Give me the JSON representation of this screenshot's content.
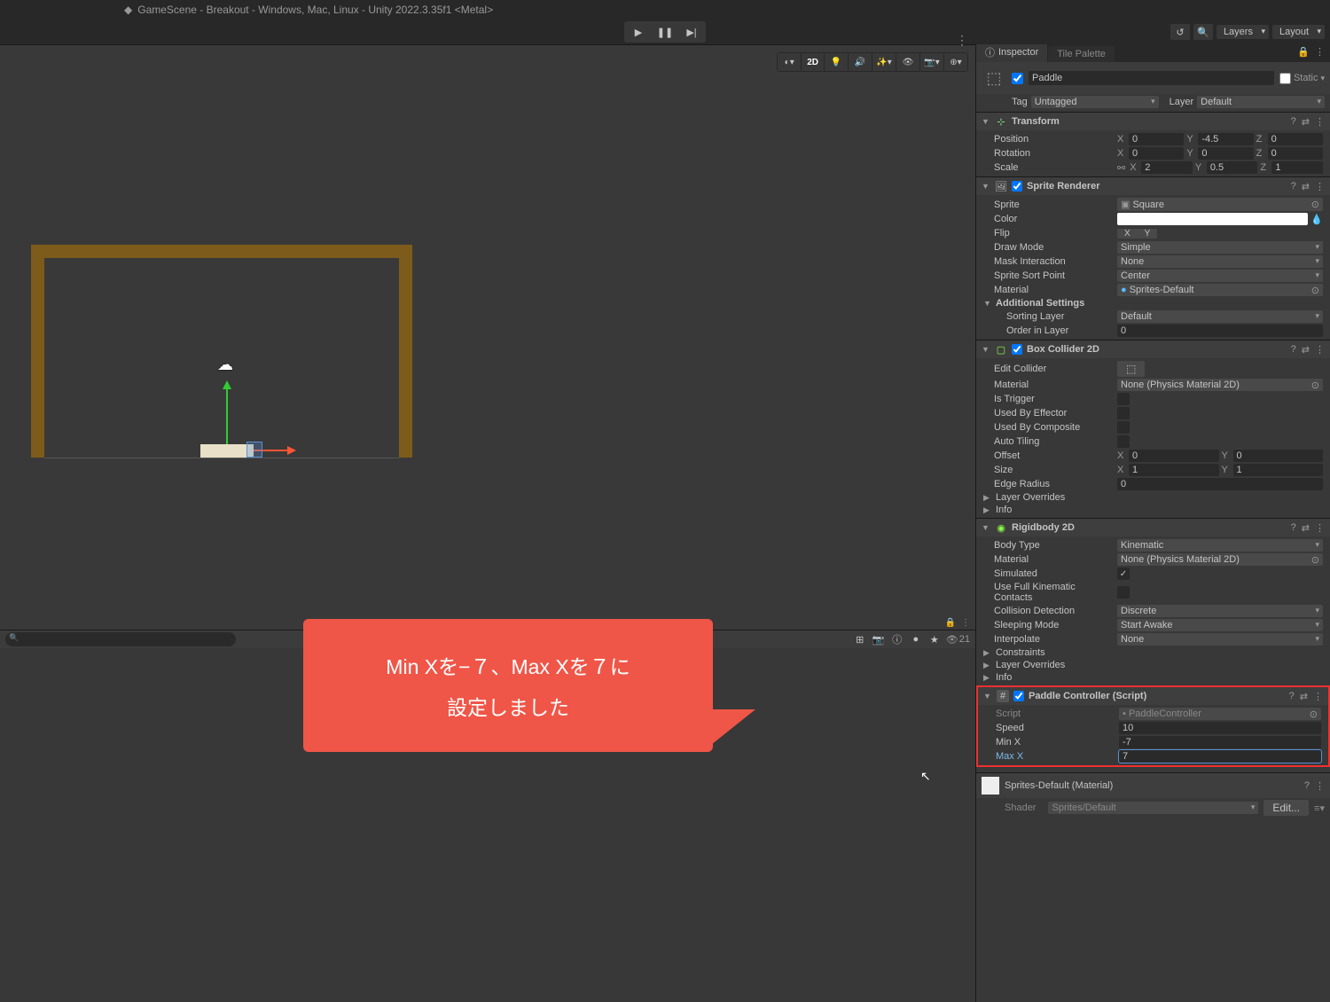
{
  "title": "GameScene - Breakout - Windows, Mac, Linux - Unity 2022.3.35f1 <Metal>",
  "toolbar": {
    "layers": "Layers",
    "layout": "Layout"
  },
  "tabs": {
    "inspector": "Inspector",
    "tilepalette": "Tile Palette"
  },
  "obj": {
    "name": "Paddle",
    "static": "Static",
    "tag_lbl": "Tag",
    "tag": "Untagged",
    "layer_lbl": "Layer",
    "layer": "Default"
  },
  "transform": {
    "title": "Transform",
    "pos_lbl": "Position",
    "px": "0",
    "py": "-4.5",
    "pz": "0",
    "rot_lbl": "Rotation",
    "rx": "0",
    "ry": "0",
    "rz": "0",
    "scl_lbl": "Scale",
    "sx": "2",
    "sy": "0.5",
    "sz": "1"
  },
  "sprite": {
    "title": "Sprite Renderer",
    "sprite_lbl": "Sprite",
    "sprite": "Square",
    "color_lbl": "Color",
    "flip_lbl": "Flip",
    "flip_x": "X",
    "flip_y": "Y",
    "draw_lbl": "Draw Mode",
    "draw": "Simple",
    "mask_lbl": "Mask Interaction",
    "mask": "None",
    "sort_lbl": "Sprite Sort Point",
    "sort": "Center",
    "mat_lbl": "Material",
    "mat": "Sprites-Default",
    "addl": "Additional Settings",
    "slayer_lbl": "Sorting Layer",
    "slayer": "Default",
    "order_lbl": "Order in Layer",
    "order": "0"
  },
  "box": {
    "title": "Box Collider 2D",
    "edit_lbl": "Edit Collider",
    "mat_lbl": "Material",
    "mat": "None (Physics Material 2D)",
    "trig_lbl": "Is Trigger",
    "eff_lbl": "Used By Effector",
    "comp_lbl": "Used By Composite",
    "auto_lbl": "Auto Tiling",
    "off_lbl": "Offset",
    "ox": "0",
    "oy": "0",
    "size_lbl": "Size",
    "sx": "1",
    "sy": "1",
    "edge_lbl": "Edge Radius",
    "edge": "0",
    "layer_ov": "Layer Overrides",
    "info": "Info"
  },
  "rb": {
    "title": "Rigidbody 2D",
    "body_lbl": "Body Type",
    "body": "Kinematic",
    "mat_lbl": "Material",
    "mat": "None (Physics Material 2D)",
    "sim_lbl": "Simulated",
    "kin_lbl": "Use Full Kinematic Contacts",
    "col_lbl": "Collision Detection",
    "col": "Discrete",
    "sleep_lbl": "Sleeping Mode",
    "sleep": "Start Awake",
    "interp_lbl": "Interpolate",
    "interp": "None",
    "cons": "Constraints",
    "layer_ov": "Layer Overrides",
    "info": "Info"
  },
  "script": {
    "title": "Paddle Controller (Script)",
    "script_lbl": "Script",
    "script": "PaddleController",
    "speed_lbl": "Speed",
    "speed": "10",
    "minx_lbl": "Min X",
    "minx": "-7",
    "maxx_lbl": "Max X",
    "maxx": "7"
  },
  "material": {
    "name": "Sprites-Default (Material)",
    "shader_lbl": "Shader",
    "shader": "Sprites/Default",
    "edit": "Edit..."
  },
  "callout": {
    "l1": "Min Xを−７、Max Xを７に",
    "l2": "設定しました"
  },
  "scene": {
    "btn2d": "2D",
    "eye_count": "21"
  },
  "axis": {
    "x": "X",
    "y": "Y",
    "z": "Z"
  }
}
